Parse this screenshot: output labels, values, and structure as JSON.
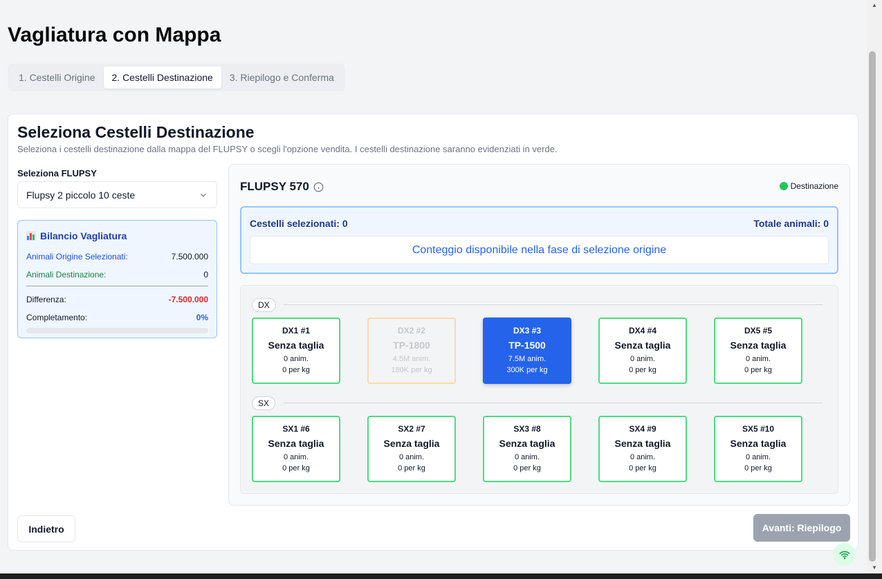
{
  "page": {
    "title": "Vagliatura con Mappa"
  },
  "tabs": [
    {
      "label": "1. Cestelli Origine"
    },
    {
      "label": "2. Cestelli Destinazione"
    },
    {
      "label": "3. Riepilogo e Conferma"
    }
  ],
  "card": {
    "title": "Seleziona Cestelli Destinazione",
    "subtitle": "Seleziona i cestelli destinazione dalla mappa del FLUPSY o scegli l'opzione vendita. I cestelli destinazione saranno evidenziati in verde."
  },
  "flupsy_select": {
    "label": "Seleziona FLUPSY",
    "value": "Flupsy 2 piccolo 10 ceste"
  },
  "balance": {
    "title": "Bilancio Vagliatura",
    "origin_label": "Animali Origine Selezionati:",
    "origin_value": "7.500.000",
    "dest_label": "Animali Destinazione:",
    "dest_value": "0",
    "diff_label": "Differenza:",
    "diff_value": "-7.500.000",
    "completion_label": "Completamento:",
    "completion_value": "0%",
    "completion_fraction": 0
  },
  "map": {
    "title": "FLUPSY 570",
    "legend_label": "Destinazione",
    "legend_color": "#22c55e",
    "selected_label": "Cestelli selezionati: 0",
    "total_label": "Totale animali: 0",
    "note": "Conteggio disponibile nella fase di selezione origine",
    "rows": [
      {
        "label": "DX",
        "baskets": [
          {
            "code": "DX1 #1",
            "size": "Senza taglia",
            "anim": "0 anim.",
            "perkg": "0 per kg",
            "state": "available"
          },
          {
            "code": "DX2 #2",
            "size": "TP-1800",
            "anim": "4.5M anim.",
            "perkg": "180K per kg",
            "state": "disabled"
          },
          {
            "code": "DX3 #3",
            "size": "TP-1500",
            "anim": "7.5M anim.",
            "perkg": "300K per kg",
            "state": "selected"
          },
          {
            "code": "DX4 #4",
            "size": "Senza taglia",
            "anim": "0 anim.",
            "perkg": "0 per kg",
            "state": "available"
          },
          {
            "code": "DX5 #5",
            "size": "Senza taglia",
            "anim": "0 anim.",
            "perkg": "0 per kg",
            "state": "available"
          }
        ]
      },
      {
        "label": "SX",
        "baskets": [
          {
            "code": "SX1 #6",
            "size": "Senza taglia",
            "anim": "0 anim.",
            "perkg": "0 per kg",
            "state": "available"
          },
          {
            "code": "SX2 #7",
            "size": "Senza taglia",
            "anim": "0 anim.",
            "perkg": "0 per kg",
            "state": "available"
          },
          {
            "code": "SX3 #8",
            "size": "Senza taglia",
            "anim": "0 anim.",
            "perkg": "0 per kg",
            "state": "available"
          },
          {
            "code": "SX4 #9",
            "size": "Senza taglia",
            "anim": "0 anim.",
            "perkg": "0 per kg",
            "state": "available"
          },
          {
            "code": "SX5 #10",
            "size": "Senza taglia",
            "anim": "0 anim.",
            "perkg": "0 per kg",
            "state": "available"
          }
        ]
      }
    ]
  },
  "buttons": {
    "back": "Indietro",
    "next": "Avanti: Riepilogo"
  },
  "icons": {
    "chart": "bar-chart-icon",
    "info": "info-icon",
    "chevron": "chevron-down-icon",
    "wifi": "wifi-icon"
  }
}
